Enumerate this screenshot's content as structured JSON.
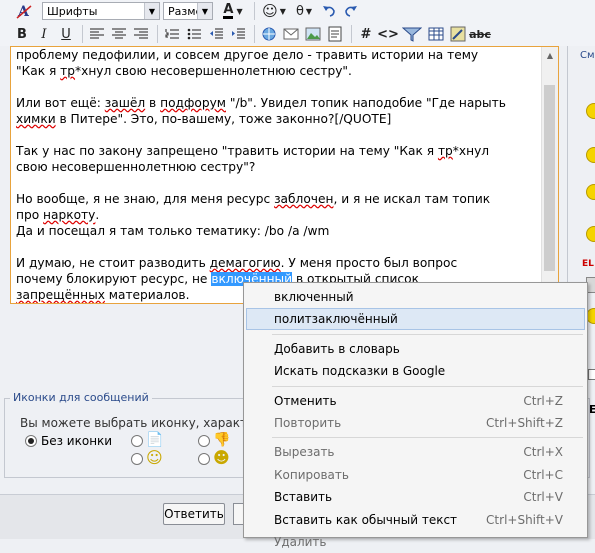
{
  "toolbar": {
    "font_placeholder": "Шрифты",
    "size_placeholder": "Разме",
    "font_color_letter": "A"
  },
  "editor": {
    "lines": [
      {
        "parts": [
          {
            "t": "проблему педофилии, и совсем другое дело - травить истории на тему"
          }
        ]
      },
      {
        "parts": [
          {
            "t": "\"Как я "
          },
          {
            "t": "тр",
            "spell": true
          },
          {
            "t": "*хнул свою несовершеннолетнюю сестру\"."
          }
        ]
      },
      {
        "gap": true
      },
      {
        "parts": [
          {
            "t": "Или вот ещё: "
          },
          {
            "t": "зашёл",
            "spell": true
          },
          {
            "t": " в "
          },
          {
            "t": "подфорум",
            "spell": true
          },
          {
            "t": " \"/b\". Увидел топик наподобие \"Где нарыть"
          }
        ]
      },
      {
        "parts": [
          {
            "t": "химки",
            "spell": true
          },
          {
            "t": " в Питере\". Это, по-вашему, тоже законно?[/QUOTE]"
          }
        ]
      },
      {
        "gap": true
      },
      {
        "parts": [
          {
            "t": "Так у нас по закону запрещено \"травить истории на тему \"Как я "
          },
          {
            "t": "тр",
            "spell": true
          },
          {
            "t": "*хнул"
          }
        ]
      },
      {
        "parts": [
          {
            "t": "свою несовершеннолетнюю сестру\"?"
          }
        ]
      },
      {
        "gap": true
      },
      {
        "parts": [
          {
            "t": "Но вообще, я не знаю, для меня ресурс "
          },
          {
            "t": "заблочен",
            "spell": true
          },
          {
            "t": ", и я не искал там топик"
          }
        ]
      },
      {
        "parts": [
          {
            "t": "про "
          },
          {
            "t": "наркоту",
            "spell": true
          },
          {
            "t": "."
          }
        ]
      },
      {
        "parts": [
          {
            "t": "Да и посещал я там только тематику: /bo /a /wm"
          }
        ]
      },
      {
        "gap": true
      },
      {
        "parts": [
          {
            "t": "И думаю, не стоит разводить "
          },
          {
            "t": "демагогию",
            "spell": true
          },
          {
            "t": ". У меня просто был вопрос"
          }
        ]
      },
      {
        "parts": [
          {
            "t": "почему блокируют ресурс, не "
          },
          {
            "t": "включённый",
            "hl": true
          },
          {
            "t": " в открытый список"
          }
        ]
      },
      {
        "parts": [
          {
            "t": "запрещённых",
            "spell": true
          },
          {
            "t": " материалов."
          }
        ]
      }
    ]
  },
  "message_icons": {
    "legend": "Иконки для сообщений",
    "description": "Вы можете выбрать иконку, характер",
    "no_icon_label": "Без иконки"
  },
  "buttons": {
    "reply": "Ответить"
  },
  "right_panel": {
    "legend": "Смa",
    "badge": "EL",
    "letter": "E"
  },
  "context_menu": {
    "items": [
      {
        "label": "включенный",
        "shortcut": "",
        "state": "normal"
      },
      {
        "label": "политзаключённый",
        "shortcut": "",
        "state": "selected"
      },
      {
        "sep": true
      },
      {
        "label": "Добавить в словарь",
        "shortcut": "",
        "state": "normal"
      },
      {
        "label": "Искать подсказки в Google",
        "shortcut": "",
        "state": "normal"
      },
      {
        "sep": true
      },
      {
        "label": "Отменить",
        "shortcut": "Ctrl+Z",
        "state": "normal"
      },
      {
        "label": "Повторить",
        "shortcut": "Ctrl+Shift+Z",
        "state": "disabled"
      },
      {
        "sep": true
      },
      {
        "label": "Вырезать",
        "shortcut": "Ctrl+X",
        "state": "disabled"
      },
      {
        "label": "Копировать",
        "shortcut": "Ctrl+C",
        "state": "disabled"
      },
      {
        "label": "Вставить",
        "shortcut": "Ctrl+V",
        "state": "normal"
      },
      {
        "label": "Вставить как обычный текст",
        "shortcut": "Ctrl+Shift+V",
        "state": "normal"
      },
      {
        "label": "Удалить",
        "shortcut": "",
        "state": "disabled"
      }
    ]
  },
  "colors": {
    "editor_border": "#e8a33d",
    "selection": "#3399ff",
    "menu_hover": "#dde8f5"
  }
}
